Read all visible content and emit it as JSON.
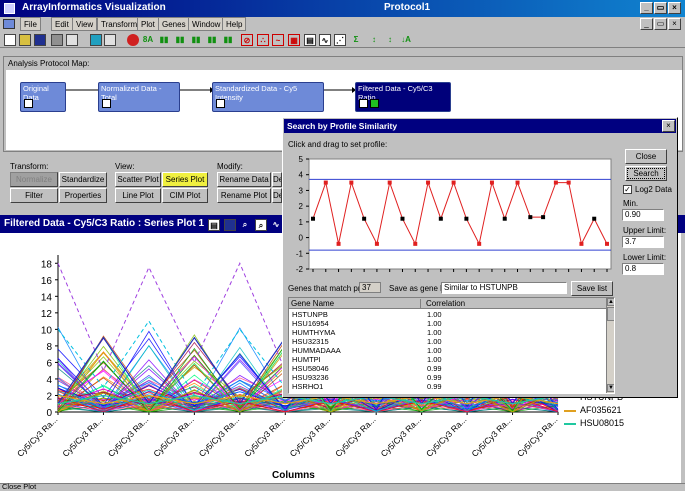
{
  "app": {
    "title": "ArrayInformatics Visualization",
    "doc_title": "Protocol1",
    "window_buttons": [
      "_",
      "×"
    ],
    "doc_window_buttons": [
      "_",
      "×"
    ]
  },
  "menu": [
    "File",
    "Edit",
    "View",
    "Transform",
    "Plot",
    "Genes",
    "Window",
    "Help"
  ],
  "protocol": {
    "label": "Analysis Protocol Map:",
    "nodes": [
      "Original Data",
      "Normalized Data - Total",
      "Standardized Data - Cy5 Intensity",
      "Filtered Data - Cy5/C3 Ratio"
    ]
  },
  "transform": {
    "label": "Transform:",
    "buttons": [
      "Normalize",
      "Standardize",
      "Filter",
      "Properties"
    ]
  },
  "view": {
    "label": "View:",
    "buttons": [
      "Scatter Plot",
      "Series Plot",
      "Line Plot",
      "CIM Plot"
    ]
  },
  "modify": {
    "label": "Modify:",
    "buttons": [
      "Rename Data",
      "Rename Plot",
      "De",
      "De"
    ]
  },
  "plot_window": {
    "title": "Filtered Data - Cy5/C3 Ratio : Series Plot 1",
    "xlabel": "Columns",
    "yticks": [
      "18",
      "16",
      "14",
      "12",
      "10",
      "8",
      "6",
      "4",
      "2",
      "0"
    ],
    "xtick_label": "Cy5/Cy3 Ra...",
    "legend": [
      {
        "name": "HSTUNPB",
        "color": "#2030c0"
      },
      {
        "name": "AF035621",
        "color": "#e0a020"
      },
      {
        "name": "HSU08015",
        "color": "#20c8a0"
      }
    ]
  },
  "dialog": {
    "title": "Search by Profile Similarity",
    "close_glyph": "×",
    "instruction": "Click and drag to set profile:",
    "close_button": "Close",
    "search_button": "Search",
    "log2_label": "Log2 Data",
    "log2_checked": true,
    "min_corr_label": "Min. Correlation:",
    "min_corr_value": "0.90",
    "upper_label": "Upper Limit:",
    "upper_value": "3.7",
    "lower_label": "Lower Limit:",
    "lower_value": "0.8",
    "matches_label": "Genes that match profile:",
    "matches_value": "37",
    "save_as_label": "Save as gene list:",
    "save_as_value": "Similar to HSTUNPB",
    "save_list_button": "Save list",
    "col_gene": "Gene Name",
    "col_corr": "Correlation",
    "rows": [
      [
        "HSTUNPB",
        "1.00"
      ],
      [
        "HSU16954",
        "1.00"
      ],
      [
        "HUMTHYMA",
        "1.00"
      ],
      [
        "HSU32315",
        "1.00"
      ],
      [
        "HUMMADAAA",
        "1.00"
      ],
      [
        "HUMTPI",
        "1.00"
      ],
      [
        "HSU58046",
        "0.99"
      ],
      [
        "HSU93236",
        "0.99"
      ],
      [
        "HSRHO1",
        "0.99"
      ]
    ],
    "yticks": [
      "5",
      "4",
      "3",
      "2",
      "1",
      "0",
      "-1",
      "-2"
    ]
  },
  "status": "Close Plot",
  "chart_data": [
    {
      "type": "line",
      "title": "",
      "xlabel": "",
      "ylabel": "",
      "ylim": [
        -2,
        5
      ],
      "hlines": [
        3.7,
        -0.8
      ],
      "series": [
        {
          "x": [
            1,
            2,
            3,
            4,
            5,
            6,
            7,
            8,
            9,
            10,
            11,
            12,
            13,
            14,
            15,
            16,
            17,
            18,
            19,
            20,
            21,
            22,
            23,
            24
          ],
          "values": [
            1.2,
            3.5,
            -0.4,
            3.5,
            1.2,
            -0.4,
            3.5,
            1.2,
            -0.4,
            3.5,
            1.2,
            3.5,
            1.2,
            -0.4,
            3.5,
            1.2,
            3.5,
            1.3,
            1.3,
            3.5,
            3.5,
            -0.4,
            1.2,
            -0.4
          ]
        }
      ]
    },
    {
      "type": "line",
      "title": "Filtered Data - Cy5/C3 Ratio : Series Plot 1",
      "xlabel": "Columns",
      "ylabel": "",
      "ylim": [
        0,
        19
      ],
      "series": [
        {
          "name": "HSTUNPB",
          "values": [
            1,
            9,
            1,
            9,
            1,
            9,
            1,
            9,
            1,
            9,
            1,
            9
          ]
        },
        {
          "name": "AF035621",
          "values": [
            2,
            1,
            2,
            1,
            2,
            1,
            2,
            1,
            2,
            1,
            2,
            1
          ]
        },
        {
          "name": "HSU08015",
          "values": [
            1,
            2,
            1,
            2,
            1,
            2,
            1,
            2,
            1,
            2,
            1,
            2
          ]
        }
      ]
    }
  ]
}
